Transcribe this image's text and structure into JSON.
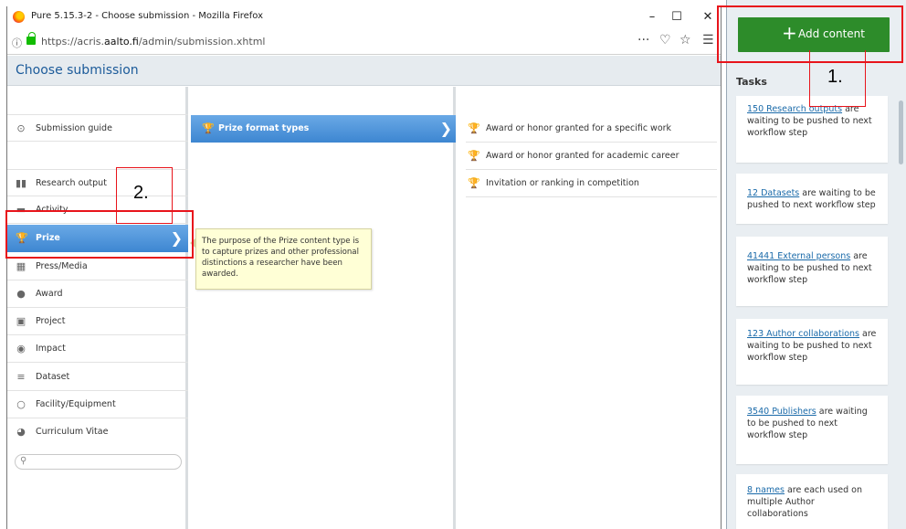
{
  "browser": {
    "title": "Pure 5.15.3-2 - Choose submission - Mozilla Firefox",
    "minimize": "–",
    "maximize": "☐",
    "close": "✕",
    "info_icon": "ⓘ",
    "url_prefix": "https://acris.",
    "url_domain": "aalto.fi",
    "url_path": "/admin/submission.xhtml",
    "menu_dots": "···",
    "pocket_icon": "♡",
    "star_icon": "☆",
    "hamburger_icon": "☰"
  },
  "page": {
    "title": "Choose submission"
  },
  "sidebar": {
    "items": [
      {
        "label": "Submission guide",
        "icon": "⊙"
      },
      {
        "label": "Research output",
        "icon": "▮▮"
      },
      {
        "label": "Activity",
        "icon": "▬"
      },
      {
        "label": "Prize",
        "icon": "🏆"
      },
      {
        "label": "Press/Media",
        "icon": "▦"
      },
      {
        "label": "Award",
        "icon": "●"
      },
      {
        "label": "Project",
        "icon": "▣"
      },
      {
        "label": "Impact",
        "icon": "◉"
      },
      {
        "label": "Dataset",
        "icon": "≡"
      },
      {
        "label": "Facility/Equipment",
        "icon": "○"
      },
      {
        "label": "Curriculum Vitae",
        "icon": "◕"
      }
    ],
    "search_placeholder": "",
    "search_icon": "⚲"
  },
  "column2": {
    "item_label": "Prize format types",
    "item_icon": "🏆",
    "tooltip": "The purpose of the Prize content type is to capture prizes and other professional distinctions a researcher have been awarded."
  },
  "column3": {
    "items": [
      {
        "label": "Award or honor granted for a specific work"
      },
      {
        "label": "Award or honor granted for academic career"
      },
      {
        "label": "Invitation or ranking in competition"
      }
    ],
    "icon": "🏆"
  },
  "right_panel": {
    "add_button": "Add content",
    "add_plus": "+",
    "tasks_title": "Tasks",
    "tasks": [
      {
        "link": "150 Research outputs",
        "text": " are waiting to be pushed to next workflow step"
      },
      {
        "link": "12 Datasets",
        "text": " are waiting to be pushed to next workflow step"
      },
      {
        "link": "41441 External persons",
        "text": " are waiting to be pushed to next workflow step"
      },
      {
        "link": "123 Author collaborations",
        "text": " are waiting to be pushed to next workflow step"
      },
      {
        "link": "3540 Publishers",
        "text": " are waiting to be pushed to next workflow step"
      },
      {
        "link": "8 names",
        "text": " are each used on multiple Author collaborations"
      }
    ]
  },
  "annotations": {
    "step1": "1.",
    "step2": "2."
  },
  "colors": {
    "accent_blue": "#3d86d1",
    "button_green": "#2d8c2a",
    "annotation_red": "#e8141b"
  }
}
